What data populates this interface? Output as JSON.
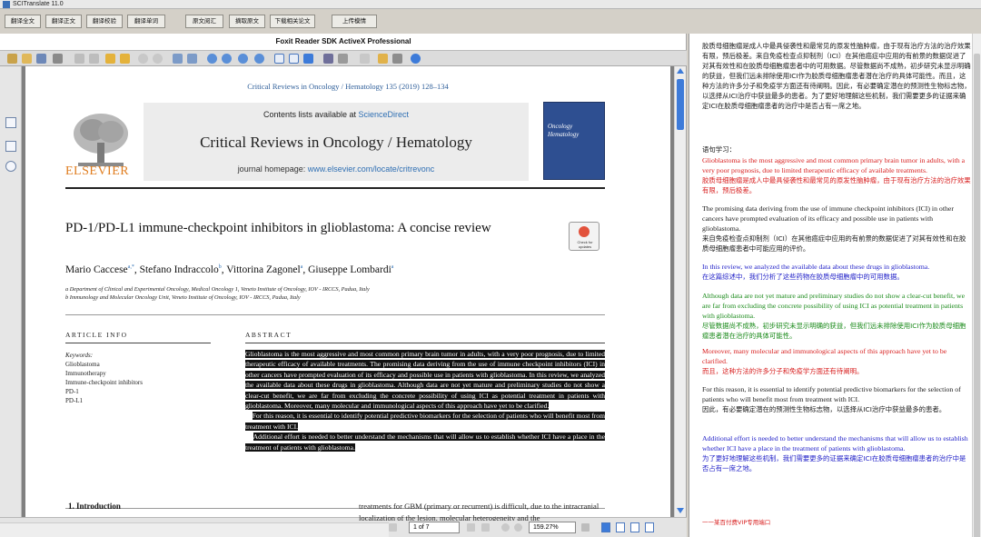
{
  "window": {
    "title": "SCITranslate 11.0"
  },
  "toolbar": {
    "buttons": [
      "翻译全文",
      "翻译正文",
      "翻译校验",
      "翻译单词",
      "原文阅汇",
      "摘取原文",
      "下载相关论文",
      "上传模情"
    ]
  },
  "pdf": {
    "viewer_title": "Foxit Reader SDK ActiveX Professional",
    "journal_ref": "Critical Reviews in Oncology / Hematology 135 (2019) 128–134",
    "contents_prefix": "Contents lists available at ",
    "contents_link": "ScienceDirect",
    "journal_title": "Critical Reviews in Oncology / Hematology",
    "homepage_prefix": "journal homepage: ",
    "homepage_url": "www.elsevier.com/locate/critrevonc",
    "publisher": "ELSEVIER",
    "cover_title": "Oncology Hematology",
    "badge_text": "Check for updates",
    "article_title": "PD-1/PD-L1 immune-checkpoint inhibitors in glioblastoma: A concise review",
    "authors": [
      {
        "name": "Mario Caccese",
        "sup": "a,*"
      },
      {
        "name": "Stefano Indraccolo",
        "sup": "b"
      },
      {
        "name": "Vittorina Zagonel",
        "sup": "a"
      },
      {
        "name": "Giuseppe Lombardi",
        "sup": "a"
      }
    ],
    "affiliations": [
      "a Department of Clinical and Experimental Oncology, Medical Oncology 1, Veneto Institute of Oncology, IOV - IRCCS, Padua, Italy",
      "b Immunology and Molecular Oncology Unit, Veneto Institute of Oncology, IOV - IRCCS, Padua, Italy"
    ],
    "article_info_head": "ARTICLE INFO",
    "abstract_head": "ABSTRACT",
    "keywords_label": "Keywords:",
    "keywords": [
      "Glioblastoma",
      "Immunotherapy",
      "Immune-checkpoint inhibitors",
      "PD-1",
      "PD-L1"
    ],
    "abstract_p1": "Glioblastoma is the most aggressive and most common primary brain tumor in adults, with a very poor prognosis, due to limited therapeutic efficacy of available treatments. The promising data deriving from the use of immune checkpoint inhibitors (ICI) in other cancers have prompted evaluation of its efficacy and possible use in patients with glioblastoma. In this review, we analyzed the available data about these drugs in glioblastoma. Although data are not yet mature and preliminary studies do not show a clear-cut benefit, we are far from excluding the concrete possibility of using ICI as potential treatment in patients with glioblastoma. Moreover, many molecular and immunological aspects of this approach have yet to be clarified.",
    "abstract_p2": "For this reason, it is essential to identify potential predictive biomarkers for the selection of patients who will benefit most from treatment with ICI.",
    "abstract_p3": "Additional effort is needed to better understand the mechanisms that will allow us to establish whether ICI have a place in the treatment of patients with glioblastoma.",
    "intro_head": "1.  Introduction",
    "intro_text": "treatments for GBM (primary or recurrent) is difficult, due to the intracranial localization of the lesion, molecular heterogeneity and the",
    "page_indicator": "1 of 7",
    "zoom": "159.27%"
  },
  "translation": {
    "summary_cn": "胶质母细胞瘤是成人中最具侵袭性和最常见的原发性脑肿瘤，由于现有治疗方法的治疗效果有限，预后极差。来自免疫检查点抑制剂（ICI）在其他癌症中应用的有前景的数据促进了对其有效性和在胶质母细胞瘤患者中的可用数据。尽管数据尚不成熟，初步研究未显示明确的获益，但我们远未排除使用ICI作为胶质母细胞瘤患者潜在治疗的具体可能性。而且，这种方法的许多分子和免疫学方面还有待阐明。因此，有必要确定潜在的预测性生物标志物，以选择从ICI治疗中获益最多的患者。为了更好地理解这些机制，我们需要更多的证据来确定ICI在胶质母细胞瘤患者的治疗中是否占有一席之地。",
    "study_label": "语句学习：",
    "sentences": [
      {
        "color": "red",
        "en": "Glioblastoma is the most aggressive and most common primary brain tumor in adults, with a very poor prognosis, due to limited therapeutic efficacy of available treatments.",
        "cn": "胶质母细胞瘤是成人中最具侵袭性和最常见的原发性脑肿瘤，由于现有治疗方法的治疗效果有限，预后极差。"
      },
      {
        "color": "black",
        "en": "The promising data deriving from the use of immune checkpoint inhibitors (ICI) in other cancers have prompted evaluation of its efficacy and possible use in patients with glioblastoma.",
        "cn": "来自免疫检查点抑制剂（ICI）在其他癌症中应用的有前景的数据促进了对其有效性和在胶质母细胞瘤患者中可能应用的评价。"
      },
      {
        "color": "blue",
        "en": "In this review, we analyzed the available data about these drugs in glioblastoma.",
        "cn": "在这篇综述中，我们分析了这些药物在胶质母细胞瘤中的可用数据。"
      },
      {
        "color": "green",
        "en": "Although data are not yet mature and preliminary studies do not show a clear-cut benefit, we are far from excluding the concrete possibility of using ICI as potential treatment in patients with glioblastoma.",
        "cn": "尽管数据尚不成熟，初步研究未显示明确的获益，但我们远未排除使用ICI作为胶质母细胞瘤患者潜在治疗的具体可能性。"
      },
      {
        "color": "red",
        "en": "Moreover, many molecular and immunological aspects of this approach have yet to be clarified.",
        "cn": "而且，这种方法的许多分子和免疫学方面还有待阐明。"
      },
      {
        "color": "black",
        "en": "For this reason, it is essential to identify potential predictive biomarkers for the selection of patients who will benefit most from treatment with ICI.",
        "cn": "因此，有必要确定潜在的预测性生物标志物，以选择从ICI治疗中获益最多的患者。"
      },
      {
        "color": "blue",
        "en": "Additional effort is needed to better understand the mechanisms that will allow us to establish whether ICI have a place in the treatment of patients with glioblastoma.",
        "cn": "为了更好地理解这些机制，我们需要更多的证据来确定ICI在胶质母细胞瘤患者的治疗中是否占有一席之地。"
      }
    ],
    "footer": "一一某百付费VIP专用端口"
  },
  "colors": {
    "highlight": "#111111",
    "link": "#2f6fb3",
    "elsevier_orange": "#e07d1f",
    "scroll_blue": "#3d7bd9",
    "red": "#d82020",
    "green": "#1a8a1a",
    "blue": "#2222c8"
  },
  "icons": [
    "app-icon",
    "save-icon",
    "print-icon",
    "first-page-icon",
    "prev-page-icon",
    "next-page-icon",
    "last-page-icon",
    "zoom-in-icon",
    "zoom-out-icon",
    "hand-tool-icon",
    "select-text-icon",
    "bookmark-icon",
    "thumbnail-icon",
    "attachment-icon"
  ]
}
